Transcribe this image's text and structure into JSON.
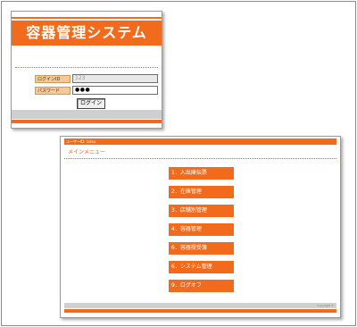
{
  "login_window": {
    "title": "容器管理システム",
    "id_label": "ログインID",
    "id_value": "123",
    "password_label": "パスワード",
    "password_value": "●●●",
    "login_button": "ログイン"
  },
  "menu_window": {
    "user_info": "ユーザーID: tatsu",
    "title": "メインメニュー",
    "items": [
      {
        "label": "1．入出庫伝票"
      },
      {
        "label": "2．在庫管理"
      },
      {
        "label": "3．店舗別管理"
      },
      {
        "label": "4．容器管理"
      },
      {
        "label": "6．容器授受簿"
      },
      {
        "label": "6．システム管理"
      },
      {
        "label": "9．ログオフ"
      }
    ],
    "footer_text": "Copyright ©"
  },
  "colors": {
    "accent": "#f26a1b",
    "label_bg": "#f5c995",
    "divider": "#7b7bd1"
  }
}
